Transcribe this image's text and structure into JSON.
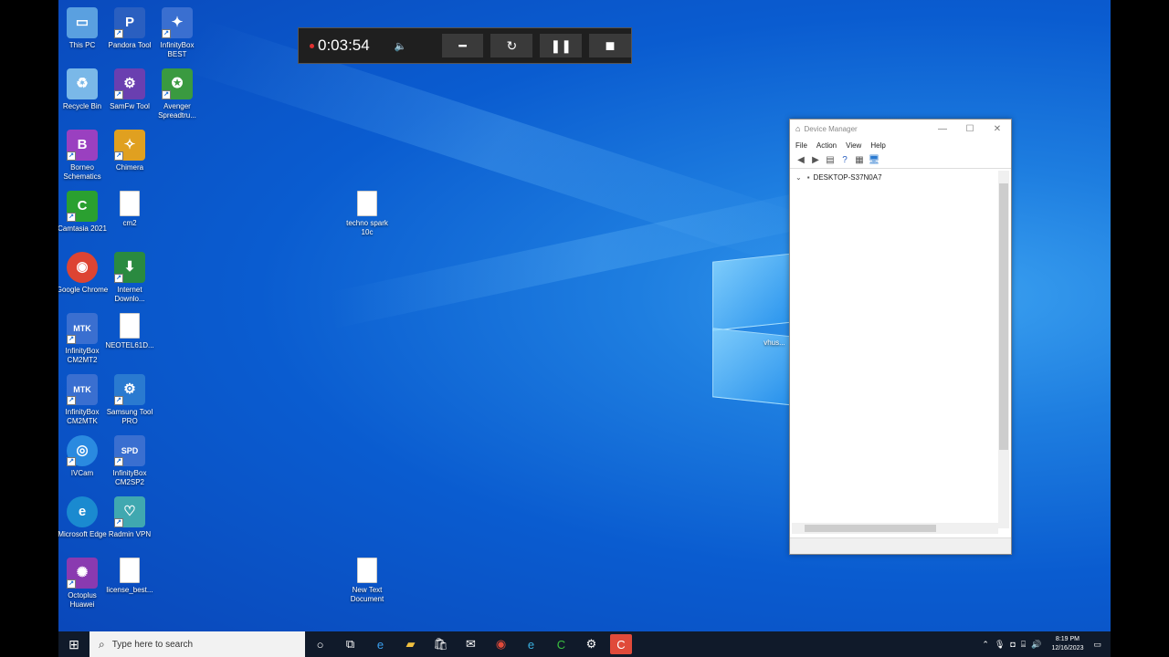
{
  "desktop_icons": [
    {
      "label": "This PC",
      "glyph": "▭",
      "color": "#5aa0e0"
    },
    {
      "label": "Pandora Tool",
      "glyph": "P",
      "color": "#2a5fc0"
    },
    {
      "label": "InfinityBox BEST",
      "glyph": "✦",
      "color": "#3a6fd0"
    },
    {
      "label": "Recycle Bin",
      "glyph": "♻",
      "color": "#7ab8e8"
    },
    {
      "label": "SamFw Tool",
      "glyph": "⚙",
      "color": "#6a3fb0"
    },
    {
      "label": "Avenger Spreadtru...",
      "glyph": "✪",
      "color": "#3a9a40"
    },
    {
      "label": "Borneo Schematics",
      "glyph": "B",
      "color": "#9a40c0"
    },
    {
      "label": "Chimera",
      "glyph": "✧",
      "color": "#e0a020"
    },
    {
      "label": "Camtasia 2021",
      "glyph": "C",
      "color": "#2aa030"
    },
    {
      "label": "cm2",
      "glyph": "",
      "color": "#ffffff"
    },
    {
      "label": "techno spark 10c",
      "glyph": "",
      "color": "#ffffff"
    },
    {
      "label": "Google Chrome",
      "glyph": "◉",
      "color": "#dd4433"
    },
    {
      "label": "Internet Downlo...",
      "glyph": "⬇",
      "color": "#2a8a40"
    },
    {
      "label": "InfinityBox CM2MT2",
      "glyph": "MTK",
      "color": "#3a6fd0"
    },
    {
      "label": "NEOTEL61D...",
      "glyph": "",
      "color": "#ffffff"
    },
    {
      "label": "InfinityBox CM2MTK",
      "glyph": "MTK",
      "color": "#3a6fd0"
    },
    {
      "label": "Samsung Tool PRO",
      "glyph": "⚙",
      "color": "#2a7ad0"
    },
    {
      "label": "IVCam",
      "glyph": "◎",
      "color": "#2a8ae0"
    },
    {
      "label": "InfinityBox CM2SP2",
      "glyph": "SPD",
      "color": "#3a6fd0"
    },
    {
      "label": "Microsoft Edge",
      "glyph": "e",
      "color": "#1a8ad0"
    },
    {
      "label": "Radmin VPN",
      "glyph": "♡",
      "color": "#40a8b0"
    },
    {
      "label": "Octoplus Huawei",
      "glyph": "✺",
      "color": "#8a3ab0"
    },
    {
      "label": "license_best...",
      "glyph": "",
      "color": "#ffffff"
    },
    {
      "label": "New Text Document",
      "glyph": "",
      "color": "#ffffff"
    },
    {
      "label": "vhus...",
      "glyph": "",
      "color": "#ffffff"
    }
  ],
  "recorder": {
    "time": "0:03:54",
    "volume_icon": "🔈",
    "minimize_icon": "━",
    "restart_icon": "↻",
    "pause_icon": "❚❚",
    "stop_icon": "■"
  },
  "device_manager": {
    "title": "Device Manager",
    "menu": [
      "File",
      "Action",
      "View",
      "Help"
    ],
    "tree_root": "DESKTOP-S37N0A7",
    "min_icon": "—",
    "max_icon": "☐",
    "close_icon": "✕"
  },
  "taskbar": {
    "start_icon": "⊞",
    "search_placeholder": "Type here to search",
    "search_icon": "⌕",
    "time": "8:19 PM",
    "date": "12/16/2023",
    "buttons": [
      "○",
      "⧉",
      "e",
      "▰",
      "🛍",
      "✉",
      "◉",
      "e",
      "C",
      "⚙",
      "C"
    ]
  }
}
